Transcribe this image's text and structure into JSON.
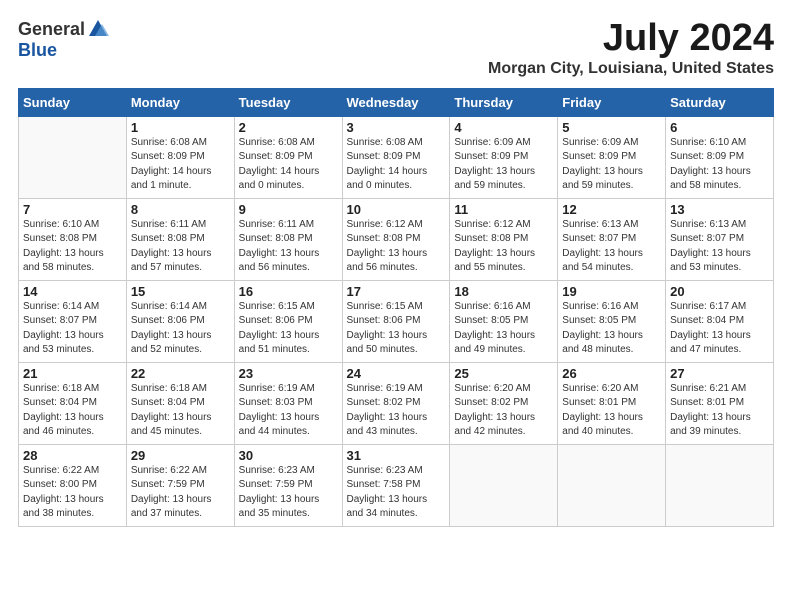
{
  "header": {
    "logo_general": "General",
    "logo_blue": "Blue",
    "month_title": "July 2024",
    "location": "Morgan City, Louisiana, United States"
  },
  "weekdays": [
    "Sunday",
    "Monday",
    "Tuesday",
    "Wednesday",
    "Thursday",
    "Friday",
    "Saturday"
  ],
  "weeks": [
    [
      {
        "day": "",
        "info": ""
      },
      {
        "day": "1",
        "info": "Sunrise: 6:08 AM\nSunset: 8:09 PM\nDaylight: 14 hours\nand 1 minute."
      },
      {
        "day": "2",
        "info": "Sunrise: 6:08 AM\nSunset: 8:09 PM\nDaylight: 14 hours\nand 0 minutes."
      },
      {
        "day": "3",
        "info": "Sunrise: 6:08 AM\nSunset: 8:09 PM\nDaylight: 14 hours\nand 0 minutes."
      },
      {
        "day": "4",
        "info": "Sunrise: 6:09 AM\nSunset: 8:09 PM\nDaylight: 13 hours\nand 59 minutes."
      },
      {
        "day": "5",
        "info": "Sunrise: 6:09 AM\nSunset: 8:09 PM\nDaylight: 13 hours\nand 59 minutes."
      },
      {
        "day": "6",
        "info": "Sunrise: 6:10 AM\nSunset: 8:09 PM\nDaylight: 13 hours\nand 58 minutes."
      }
    ],
    [
      {
        "day": "7",
        "info": "Sunrise: 6:10 AM\nSunset: 8:08 PM\nDaylight: 13 hours\nand 58 minutes."
      },
      {
        "day": "8",
        "info": "Sunrise: 6:11 AM\nSunset: 8:08 PM\nDaylight: 13 hours\nand 57 minutes."
      },
      {
        "day": "9",
        "info": "Sunrise: 6:11 AM\nSunset: 8:08 PM\nDaylight: 13 hours\nand 56 minutes."
      },
      {
        "day": "10",
        "info": "Sunrise: 6:12 AM\nSunset: 8:08 PM\nDaylight: 13 hours\nand 56 minutes."
      },
      {
        "day": "11",
        "info": "Sunrise: 6:12 AM\nSunset: 8:08 PM\nDaylight: 13 hours\nand 55 minutes."
      },
      {
        "day": "12",
        "info": "Sunrise: 6:13 AM\nSunset: 8:07 PM\nDaylight: 13 hours\nand 54 minutes."
      },
      {
        "day": "13",
        "info": "Sunrise: 6:13 AM\nSunset: 8:07 PM\nDaylight: 13 hours\nand 53 minutes."
      }
    ],
    [
      {
        "day": "14",
        "info": "Sunrise: 6:14 AM\nSunset: 8:07 PM\nDaylight: 13 hours\nand 53 minutes."
      },
      {
        "day": "15",
        "info": "Sunrise: 6:14 AM\nSunset: 8:06 PM\nDaylight: 13 hours\nand 52 minutes."
      },
      {
        "day": "16",
        "info": "Sunrise: 6:15 AM\nSunset: 8:06 PM\nDaylight: 13 hours\nand 51 minutes."
      },
      {
        "day": "17",
        "info": "Sunrise: 6:15 AM\nSunset: 8:06 PM\nDaylight: 13 hours\nand 50 minutes."
      },
      {
        "day": "18",
        "info": "Sunrise: 6:16 AM\nSunset: 8:05 PM\nDaylight: 13 hours\nand 49 minutes."
      },
      {
        "day": "19",
        "info": "Sunrise: 6:16 AM\nSunset: 8:05 PM\nDaylight: 13 hours\nand 48 minutes."
      },
      {
        "day": "20",
        "info": "Sunrise: 6:17 AM\nSunset: 8:04 PM\nDaylight: 13 hours\nand 47 minutes."
      }
    ],
    [
      {
        "day": "21",
        "info": "Sunrise: 6:18 AM\nSunset: 8:04 PM\nDaylight: 13 hours\nand 46 minutes."
      },
      {
        "day": "22",
        "info": "Sunrise: 6:18 AM\nSunset: 8:04 PM\nDaylight: 13 hours\nand 45 minutes."
      },
      {
        "day": "23",
        "info": "Sunrise: 6:19 AM\nSunset: 8:03 PM\nDaylight: 13 hours\nand 44 minutes."
      },
      {
        "day": "24",
        "info": "Sunrise: 6:19 AM\nSunset: 8:02 PM\nDaylight: 13 hours\nand 43 minutes."
      },
      {
        "day": "25",
        "info": "Sunrise: 6:20 AM\nSunset: 8:02 PM\nDaylight: 13 hours\nand 42 minutes."
      },
      {
        "day": "26",
        "info": "Sunrise: 6:20 AM\nSunset: 8:01 PM\nDaylight: 13 hours\nand 40 minutes."
      },
      {
        "day": "27",
        "info": "Sunrise: 6:21 AM\nSunset: 8:01 PM\nDaylight: 13 hours\nand 39 minutes."
      }
    ],
    [
      {
        "day": "28",
        "info": "Sunrise: 6:22 AM\nSunset: 8:00 PM\nDaylight: 13 hours\nand 38 minutes."
      },
      {
        "day": "29",
        "info": "Sunrise: 6:22 AM\nSunset: 7:59 PM\nDaylight: 13 hours\nand 37 minutes."
      },
      {
        "day": "30",
        "info": "Sunrise: 6:23 AM\nSunset: 7:59 PM\nDaylight: 13 hours\nand 35 minutes."
      },
      {
        "day": "31",
        "info": "Sunrise: 6:23 AM\nSunset: 7:58 PM\nDaylight: 13 hours\nand 34 minutes."
      },
      {
        "day": "",
        "info": ""
      },
      {
        "day": "",
        "info": ""
      },
      {
        "day": "",
        "info": ""
      }
    ]
  ]
}
